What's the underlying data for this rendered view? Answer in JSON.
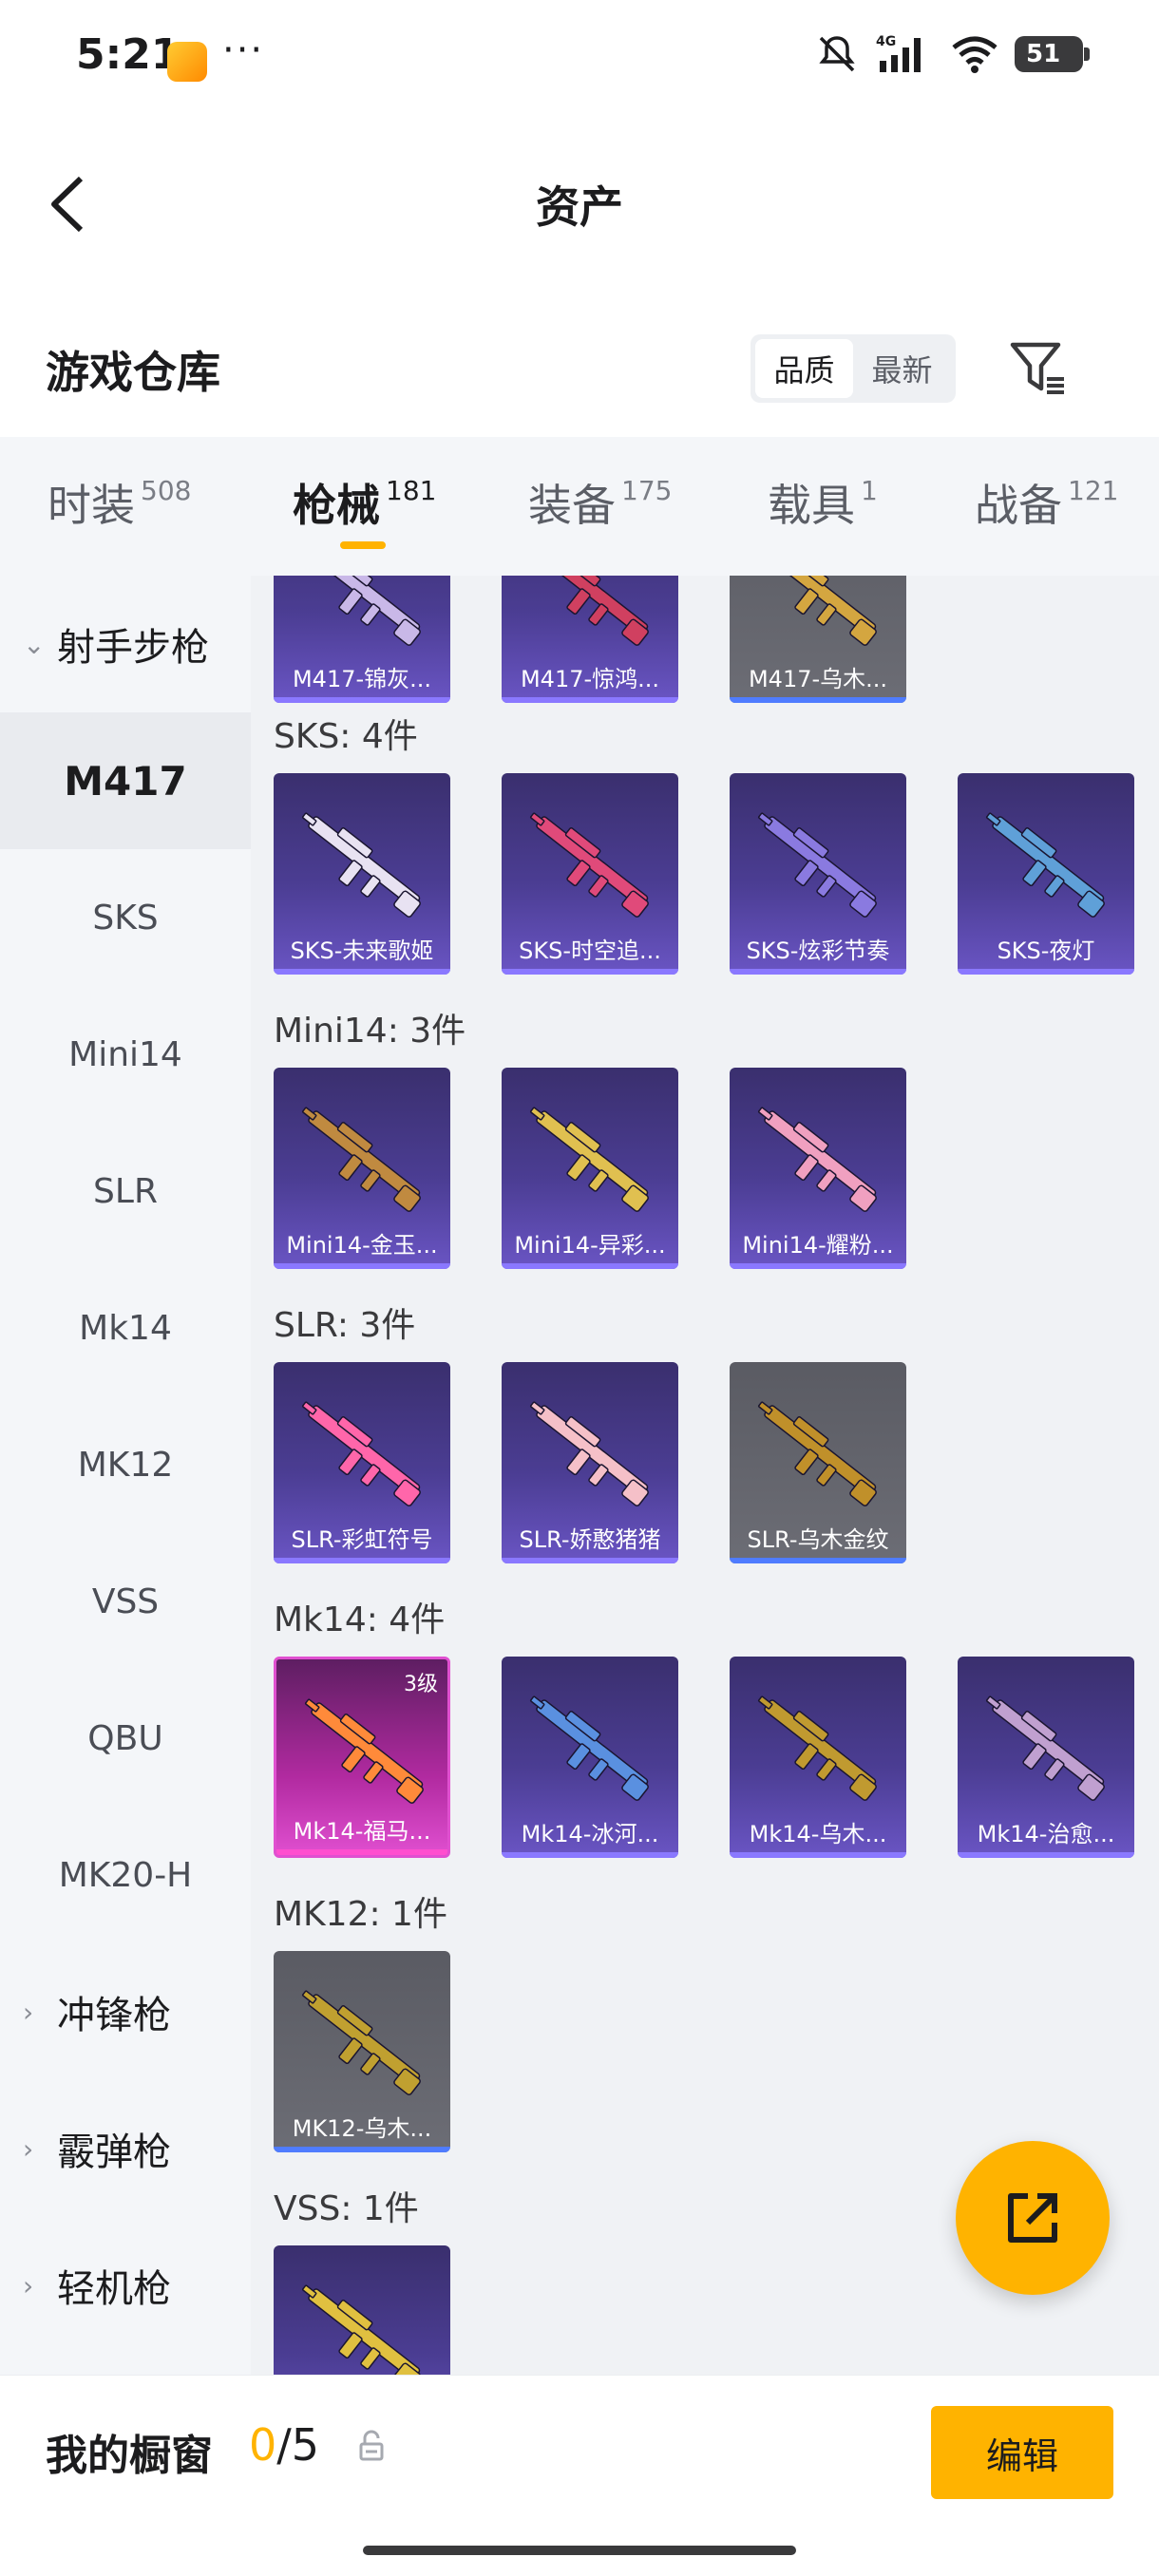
{
  "status_bar": {
    "time": "5:21",
    "more": "···",
    "network": "4G",
    "battery": "51"
  },
  "header": {
    "title": "资产"
  },
  "section": {
    "title": "游戏仓库",
    "sort_options": [
      "品质",
      "最新"
    ],
    "sort_selected": "品质"
  },
  "tabs": [
    {
      "label": "时装",
      "count": "508"
    },
    {
      "label": "枪械",
      "count": "181",
      "active": true
    },
    {
      "label": "装备",
      "count": "175"
    },
    {
      "label": "载具",
      "count": "1"
    },
    {
      "label": "战备",
      "count": "121"
    }
  ],
  "sidebar": {
    "group_open": "射手步枪",
    "items": [
      "M417",
      "SKS",
      "Mini14",
      "SLR",
      "Mk14",
      "MK12",
      "VSS",
      "QBU",
      "MK20-H"
    ],
    "active": "M417",
    "groups_closed": [
      "冲锋枪",
      "霰弹枪",
      "轻机枪"
    ]
  },
  "groups": [
    {
      "title": "",
      "items": [
        {
          "name": "M417-锦灰...",
          "rarity": "purple"
        },
        {
          "name": "M417-惊鸿...",
          "rarity": "purple"
        },
        {
          "name": "M417-乌木...",
          "rarity": "gray"
        }
      ]
    },
    {
      "title": "SKS: 4件",
      "items": [
        {
          "name": "SKS-未来歌姬",
          "rarity": "purple"
        },
        {
          "name": "SKS-时空追...",
          "rarity": "purple"
        },
        {
          "name": "SKS-炫彩节奏",
          "rarity": "purple"
        },
        {
          "name": "SKS-夜灯",
          "rarity": "purple"
        }
      ]
    },
    {
      "title": "Mini14: 3件",
      "items": [
        {
          "name": "Mini14-金玉...",
          "rarity": "purple"
        },
        {
          "name": "Mini14-异彩...",
          "rarity": "purple"
        },
        {
          "name": "Mini14-耀粉...",
          "rarity": "purple"
        }
      ]
    },
    {
      "title": "SLR: 3件",
      "items": [
        {
          "name": "SLR-彩虹符号",
          "rarity": "purple"
        },
        {
          "name": "SLR-娇憨猪猪",
          "rarity": "purple"
        },
        {
          "name": "SLR-乌木金纹",
          "rarity": "gray"
        }
      ]
    },
    {
      "title": "Mk14: 4件",
      "items": [
        {
          "name": "Mk14-福马...",
          "rarity": "pink",
          "level": "3级"
        },
        {
          "name": "Mk14-冰河...",
          "rarity": "purple"
        },
        {
          "name": "Mk14-乌木...",
          "rarity": "purple"
        },
        {
          "name": "Mk14-治愈...",
          "rarity": "purple"
        }
      ]
    },
    {
      "title": "MK12: 1件",
      "items": [
        {
          "name": "MK12-乌木...",
          "rarity": "gray"
        }
      ]
    },
    {
      "title": "VSS: 1件",
      "items": [
        {
          "name": "",
          "rarity": "purple"
        }
      ]
    }
  ],
  "gun_colors": [
    "#c9b8e8",
    "#d04060",
    "#d4a640",
    "#e8e2f2",
    "#e04a7a",
    "#8a7ae0",
    "#5fa0d8",
    "#c08a40",
    "#e0c050",
    "#f0a0c0",
    "#ff66aa",
    "#f5c0c8",
    "#c0902a",
    "#ff8a3a",
    "#5a90e0",
    "#c09a30",
    "#c0a0d0",
    "#c0a030",
    "#e0c040"
  ],
  "bottom": {
    "label": "我的橱窗",
    "count_current": "0",
    "count_total": "/5",
    "edit": "编辑"
  },
  "colors": {
    "accent": "#ffb300"
  }
}
